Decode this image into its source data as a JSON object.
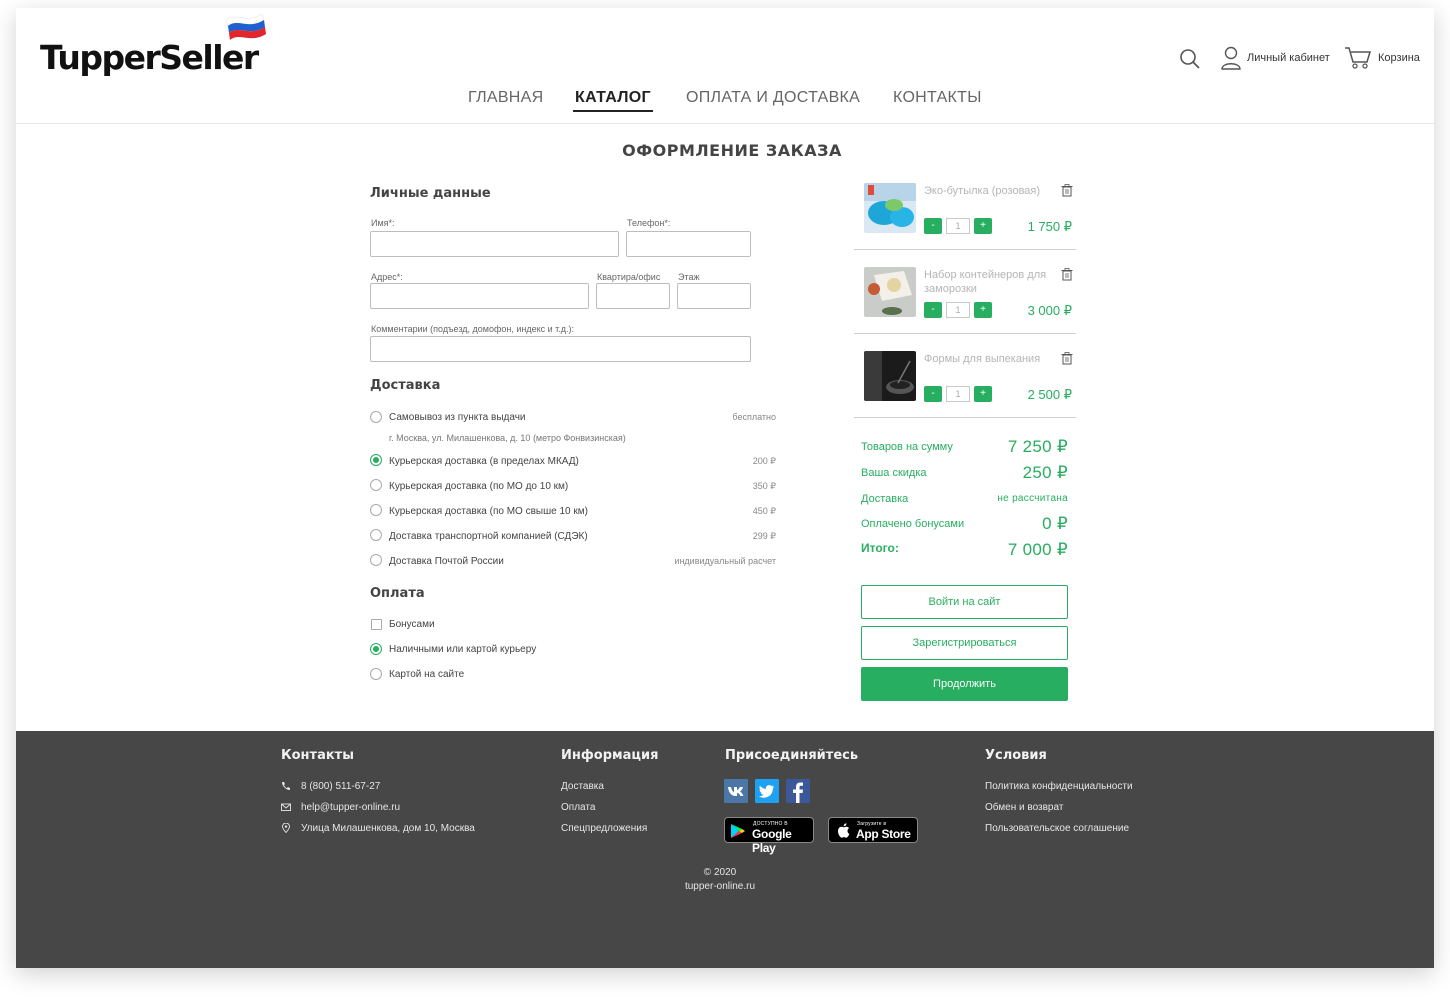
{
  "brand": {
    "logo_text": "TupperSeller",
    "accent": "#27ae60"
  },
  "header": {
    "account_label": "Личный кабинет",
    "cart_label": "Корзина",
    "icons": [
      "search-icon",
      "user-icon",
      "cart-icon"
    ]
  },
  "nav": {
    "items": [
      {
        "label": "ГЛАВНАЯ"
      },
      {
        "label": "КАТАЛОГ",
        "active": true
      },
      {
        "label": "ОПЛАТА И ДОСТАВКА"
      },
      {
        "label": "КОНТАКТЫ"
      }
    ]
  },
  "page_title": "ОФОРМЛЕНИЕ ЗАКАЗА",
  "personal": {
    "title": "Личные данные",
    "name_label": "Имя*:",
    "phone_label": "Телефон*:",
    "address_label": "Адрес*:",
    "apartment_label": "Квартира/офис",
    "floor_label": "Этаж",
    "comment_label": "Комментарии (подъезд, домофон, индекс и т.д.):",
    "name_value": "",
    "phone_value": "",
    "address_value": "",
    "apartment_value": "",
    "floor_value": "",
    "comment_value": ""
  },
  "delivery": {
    "title": "Доставка",
    "options": [
      {
        "label": "Самовывоз из пункта выдачи",
        "price": "бесплатно",
        "sub": "г. Москва, ул. Милашенкова, д. 10 (метро Фонвизинская)",
        "selected": false
      },
      {
        "label": "Курьерская доставка (в пределах МКАД)",
        "price": "200 ₽",
        "selected": true
      },
      {
        "label": "Курьерская доставка (по МО до 10 км)",
        "price": "350 ₽",
        "selected": false
      },
      {
        "label": "Курьерская доставка (по МО свыше 10 км)",
        "price": "450 ₽",
        "selected": false
      },
      {
        "label": "Доставка транспортной компанией (СДЭК)",
        "price": "299 ₽",
        "selected": false
      },
      {
        "label": "Доставка Почтой России",
        "price": "индивидуальный расчет",
        "selected": false
      }
    ]
  },
  "payment": {
    "title": "Оплата",
    "options": [
      {
        "label": "Бонусами",
        "type": "checkbox",
        "selected": false
      },
      {
        "label": "Наличными или картой курьеру",
        "type": "radio",
        "selected": true
      },
      {
        "label": "Картой на сайте",
        "type": "radio",
        "selected": false
      }
    ]
  },
  "cart": {
    "items": [
      {
        "name": "Эко-бутылка (розовая)",
        "qty": "1",
        "price": "1 750 ₽",
        "minus": "-",
        "plus": "+"
      },
      {
        "name": "Набор контейнеров для заморозки",
        "qty": "1",
        "price": "3 000 ₽",
        "minus": "-",
        "plus": "+"
      },
      {
        "name": "Формы для выпекания",
        "qty": "1",
        "price": "2 500 ₽",
        "minus": "-",
        "plus": "+"
      }
    ],
    "summary": {
      "subtotal_label": "Товаров на сумму",
      "subtotal": "7 250 ₽",
      "discount_label": "Ваша скидка",
      "discount": "250 ₽",
      "delivery_label": "Доставка",
      "delivery": "не рассчитана",
      "bonus_label": "Оплачено бонусами",
      "bonus": "0 ₽",
      "total_label": "Итого:",
      "total": "7 000 ₽"
    },
    "login_button": "Войти на сайт",
    "register_button": "Зарегистрироваться",
    "continue_button": "Продолжить"
  },
  "footer": {
    "contacts_title": "Контакты",
    "phone": "8 (800) 511-67-27",
    "email": "help@tupper-online.ru",
    "address": "Улица Милашенкова,  дом 10,  Москва",
    "info_title": "Информация",
    "info_links": [
      "Доставка",
      "Оплата",
      "Спецпредложения"
    ],
    "join_title": "Присоединяйтесь",
    "google_small": "ДОСТУПНО В",
    "google_big": "Google Play",
    "apple_small": "Загрузите в",
    "apple_big": "App Store",
    "terms_title": "Условия",
    "terms_links": [
      "Политика конфиденциальности",
      "Обмен и возврат",
      "Пользовательское соглашение"
    ],
    "copyright": "© 2020",
    "site": "tupper-online.ru"
  }
}
